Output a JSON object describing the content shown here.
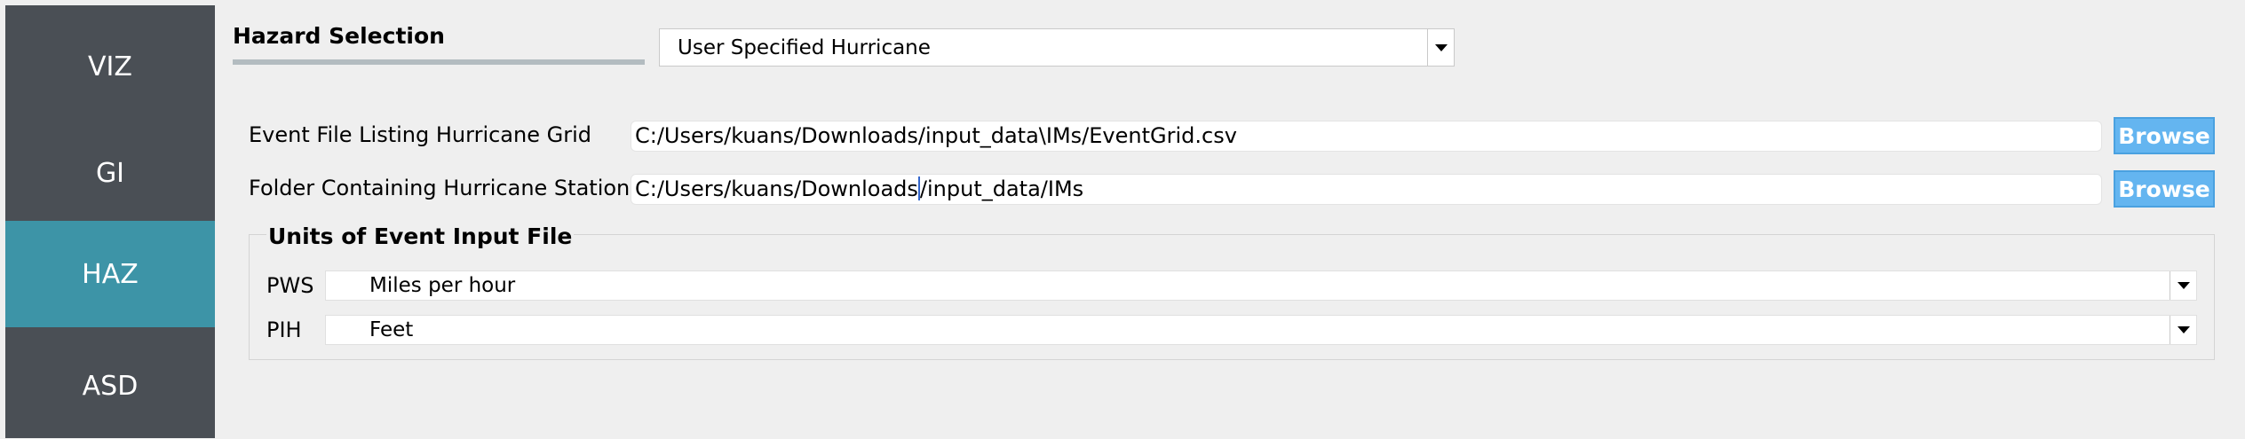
{
  "sidebar": {
    "items": [
      {
        "label": "VIZ",
        "active": false
      },
      {
        "label": "GI",
        "active": false
      },
      {
        "label": "HAZ",
        "active": true
      },
      {
        "label": "ASD",
        "active": false
      }
    ],
    "background": "#4a4f55",
    "active_color": "#3d94a7"
  },
  "hazard": {
    "title": "Hazard Selection",
    "selected": "User Specified Hurricane",
    "dropdown_icon": "chevron-down-icon"
  },
  "event_file": {
    "label": "Event File Listing Hurricane Grid",
    "value": "C:/Users/kuans/Downloads/input_data\\IMs/EventGrid.csv",
    "button": "Browse"
  },
  "station_folder": {
    "label": "Folder Containing Hurricane Stations",
    "value_before_cursor": "C:/Users/kuans/Downloads",
    "value_after_cursor": "/input_data/IMs",
    "button": "Browse"
  },
  "units": {
    "title": "Units of Event Input File",
    "pws": {
      "label": "PWS",
      "selected": "Miles per hour"
    },
    "pih": {
      "label": "PIH",
      "selected": "Feet"
    }
  },
  "colors": {
    "browse_button": "#64b5f0",
    "panel_background": "#efefef"
  }
}
